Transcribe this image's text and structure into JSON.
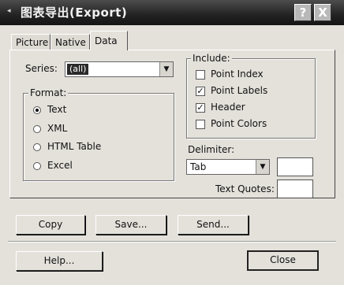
{
  "window": {
    "title": "图表导出(Export)"
  },
  "titlebar": {
    "help_glyph": "?",
    "close_glyph": "X"
  },
  "tabs": [
    {
      "label": "Picture",
      "active": false
    },
    {
      "label": "Native",
      "active": false
    },
    {
      "label": "Data",
      "active": true
    }
  ],
  "series": {
    "label": "Series:",
    "value": "(all)"
  },
  "format": {
    "label": "Format:",
    "options": [
      {
        "label": "Text",
        "selected": true
      },
      {
        "label": "XML",
        "selected": false
      },
      {
        "label": "HTML Table",
        "selected": false
      },
      {
        "label": "Excel",
        "selected": false
      }
    ]
  },
  "include": {
    "label": "Include:",
    "options": [
      {
        "label": "Point Index",
        "checked": false
      },
      {
        "label": "Point Labels",
        "checked": true
      },
      {
        "label": "Header",
        "checked": true
      },
      {
        "label": "Point Colors",
        "checked": false
      }
    ]
  },
  "delimiter": {
    "label": "Delimiter:",
    "value": "Tab",
    "custom_value": ""
  },
  "text_quotes": {
    "label": "Text Quotes:",
    "value": ""
  },
  "buttons": {
    "copy": "Copy",
    "save": "Save...",
    "send": "Send...",
    "help": "Help...",
    "close": "Close"
  },
  "check_glyph": "✓"
}
